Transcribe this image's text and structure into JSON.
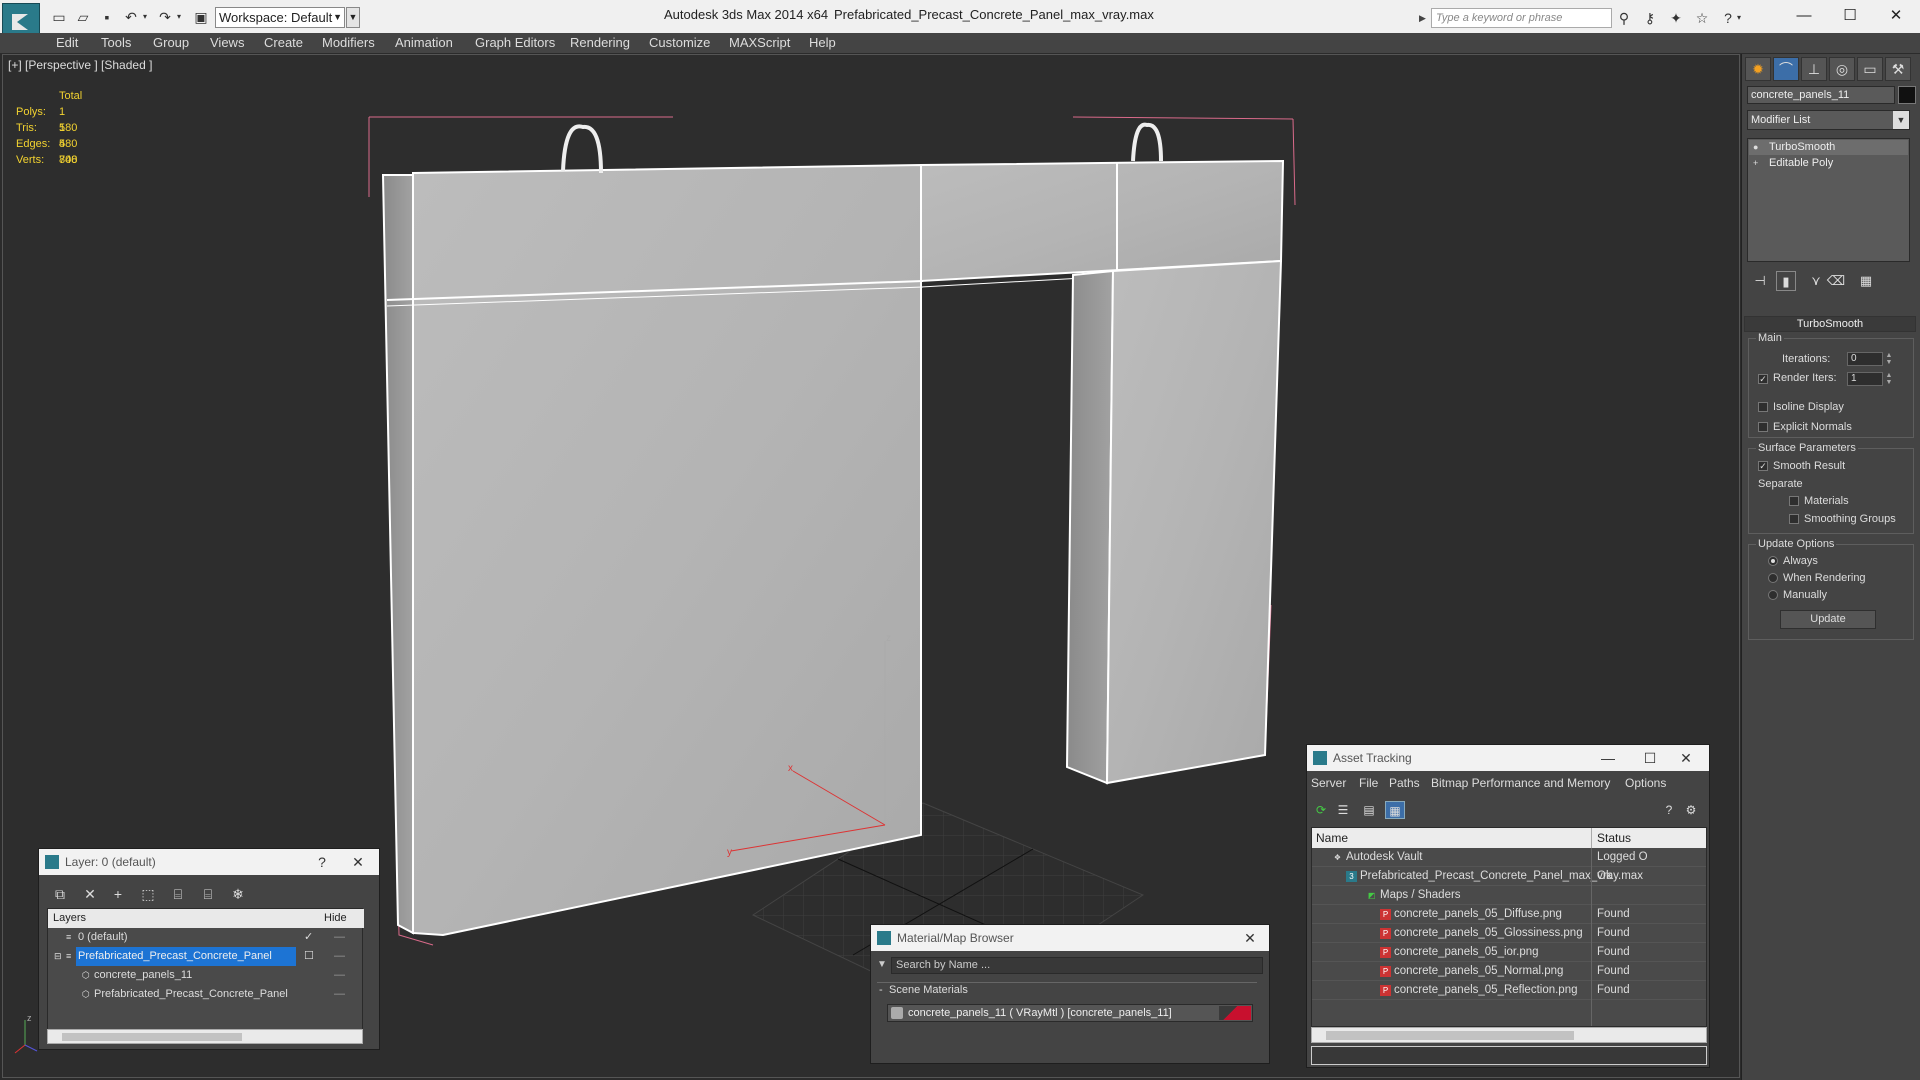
{
  "titlebar": {
    "workspace": "Workspace: Default",
    "app_title": "Autodesk 3ds Max  2014 x64",
    "file_title": "Prefabricated_Precast_Concrete_Panel_max_vray.max",
    "search_placeholder": "Type a keyword or phrase"
  },
  "menu": [
    "Edit",
    "Tools",
    "Group",
    "Views",
    "Create",
    "Modifiers",
    "Animation",
    "Graph Editors",
    "Rendering",
    "Customize",
    "MAXScript",
    "Help"
  ],
  "viewport": {
    "label": "[+] [Perspective ] [Shaded ]",
    "stats": {
      "header": "Total",
      "rows": [
        {
          "k": "Polys:",
          "v": "1 580"
        },
        {
          "k": "Tris:",
          "v": "1 580"
        },
        {
          "k": "Edges:",
          "v": "4 740"
        },
        {
          "k": "Verts:",
          "v": "808"
        }
      ]
    },
    "axis": {
      "x": "x",
      "y": "y",
      "z": "z"
    }
  },
  "command_panel": {
    "object_name": "concrete_panels_11",
    "modifier_list": "Modifier List",
    "stack": [
      "TurboSmooth",
      "Editable Poly"
    ],
    "rollout_title": "TurboSmooth",
    "main_label": "Main",
    "iterations_label": "Iterations:",
    "iterations_value": "0",
    "render_iters_label": "Render Iters:",
    "render_iters_value": "1",
    "isoline_display": "Isoline Display",
    "explicit_normals": "Explicit Normals",
    "surface_params": "Surface Parameters",
    "smooth_result": "Smooth Result",
    "separate": "Separate",
    "materials": "Materials",
    "smoothing_groups": "Smoothing Groups",
    "update_options": "Update Options",
    "always": "Always",
    "when_rendering": "When Rendering",
    "manually": "Manually",
    "update_button": "Update"
  },
  "layer_window": {
    "title": "Layer: 0 (default)",
    "help": "?",
    "col_layers": "Layers",
    "col_hide": "Hide",
    "rows": [
      {
        "name": "0 (default)"
      },
      {
        "name": "Prefabricated_Precast_Concrete_Panel"
      },
      {
        "name": "concrete_panels_11"
      },
      {
        "name": "Prefabricated_Precast_Concrete_Panel"
      }
    ]
  },
  "material_browser": {
    "title": "Material/Map Browser",
    "search_placeholder": "Search by Name ...",
    "category": "Scene Materials",
    "item": "concrete_panels_11  ( VRayMtl )  [concrete_panels_11]"
  },
  "asset_tracking": {
    "title": "Asset Tracking",
    "menu": [
      "Server",
      "File",
      "Paths",
      "Bitmap Performance and Memory",
      "Options"
    ],
    "col_name": "Name",
    "col_status": "Status",
    "rows": [
      {
        "name": "Autodesk Vault",
        "status": "Logged O"
      },
      {
        "name": "Prefabricated_Precast_Concrete_Panel_max_vray.max",
        "status": "Ok"
      },
      {
        "name": "Maps / Shaders",
        "status": ""
      },
      {
        "name": "concrete_panels_05_Diffuse.png",
        "status": "Found"
      },
      {
        "name": "concrete_panels_05_Glossiness.png",
        "status": "Found"
      },
      {
        "name": "concrete_panels_05_ior.png",
        "status": "Found"
      },
      {
        "name": "concrete_panels_05_Normal.png",
        "status": "Found"
      },
      {
        "name": "concrete_panels_05_Reflection.png",
        "status": "Found"
      }
    ]
  },
  "colors": {
    "accent_blue": "#1d74d4",
    "stats_yellow": "#f2d230",
    "material_swatch": "#c8102e"
  }
}
